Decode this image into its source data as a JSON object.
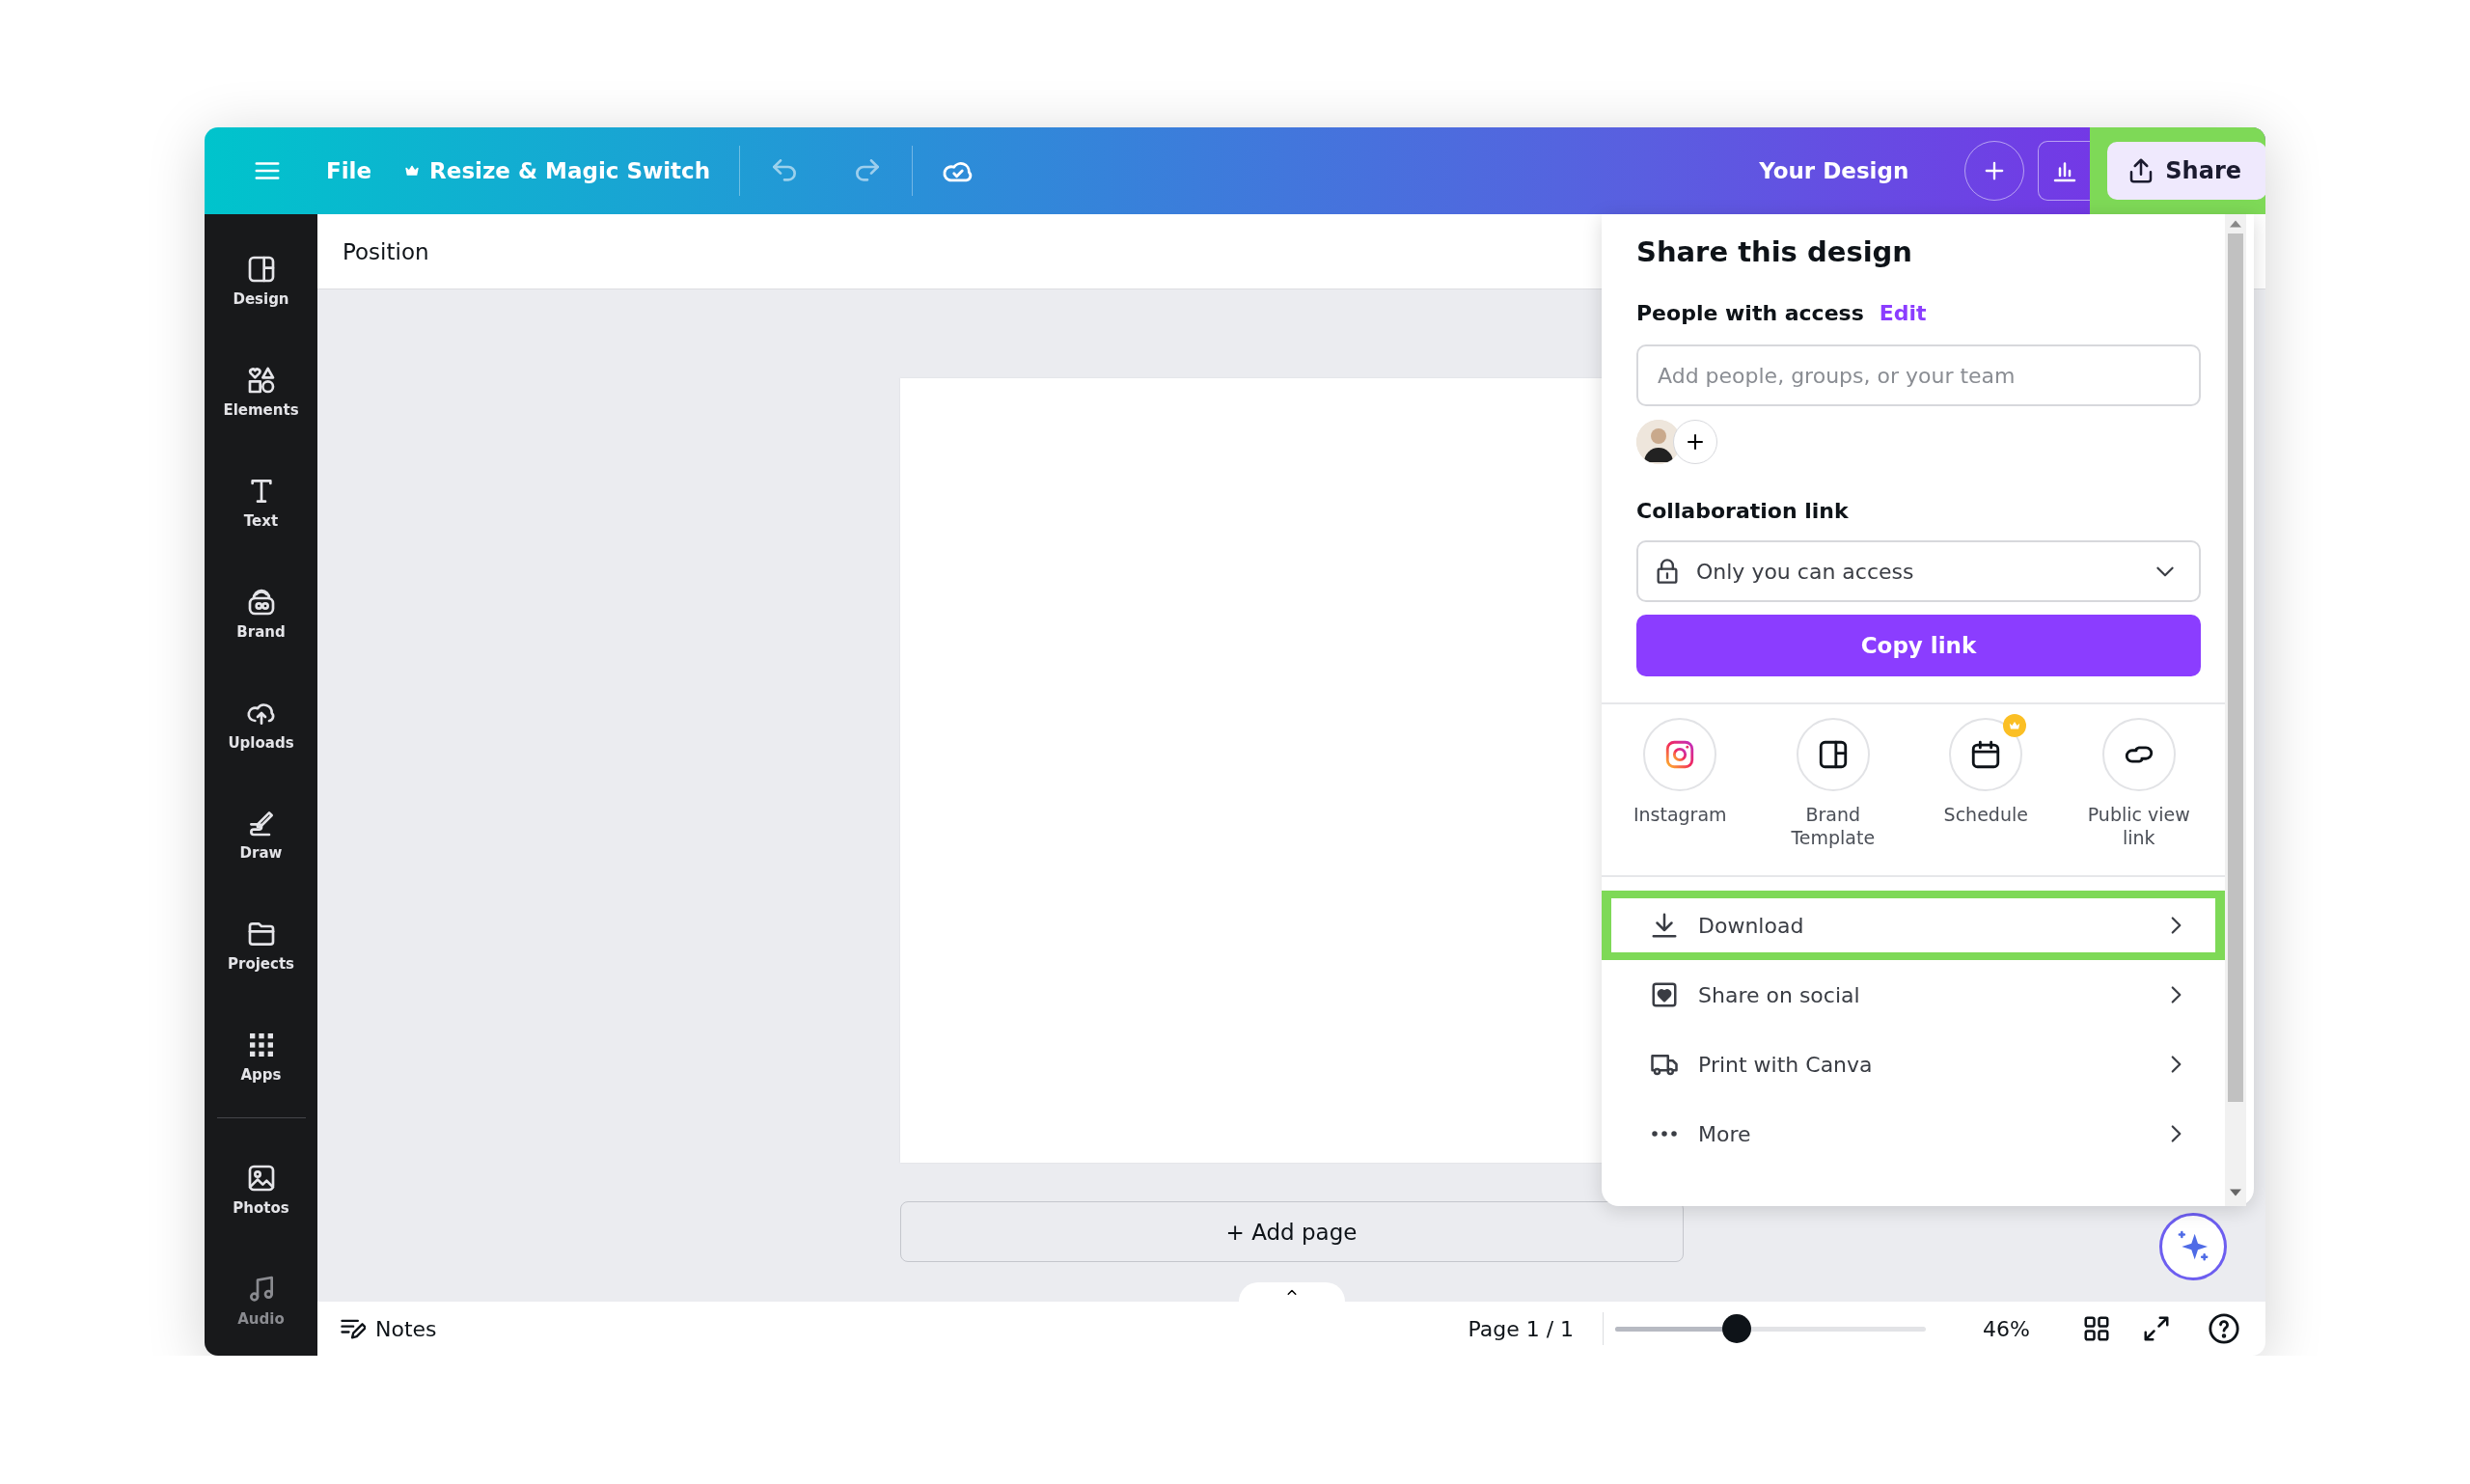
{
  "topbar": {
    "file_menu": "File",
    "resize_button": "Resize & Magic Switch",
    "design_title": "Your Design",
    "share_button": {
      "label": "Share",
      "highlighted": true
    }
  },
  "sidebar": {
    "items": [
      {
        "kind": "design",
        "label": "Design",
        "dimmed": false
      },
      {
        "kind": "elements",
        "label": "Elements",
        "dimmed": false
      },
      {
        "kind": "text",
        "label": "Text",
        "dimmed": false
      },
      {
        "kind": "brand",
        "label": "Brand",
        "dimmed": false
      },
      {
        "kind": "uploads",
        "label": "Uploads",
        "dimmed": false
      },
      {
        "kind": "draw",
        "label": "Draw",
        "dimmed": false
      },
      {
        "kind": "projects",
        "label": "Projects",
        "dimmed": false
      },
      {
        "kind": "apps",
        "label": "Apps",
        "dimmed": false
      },
      {
        "kind": "photos",
        "label": "Photos",
        "dimmed": false
      },
      {
        "kind": "audio",
        "label": "Audio",
        "dimmed": true
      }
    ]
  },
  "context_bar": {
    "label": "Position"
  },
  "canvas": {
    "add_page_button": "+ Add page"
  },
  "share_panel": {
    "title": "Share this design",
    "people_label": "People with access",
    "edit_link": "Edit",
    "people_field": {
      "placeholder": "Add people, groups, or your team"
    },
    "collaboration_label": "Collaboration link",
    "access_dropdown": "Only you can access",
    "copy_button": "Copy link",
    "targets": [
      {
        "kind": "instagram",
        "label": "Instagram",
        "premium": false
      },
      {
        "kind": "template",
        "label": "Brand Template",
        "premium": false
      },
      {
        "kind": "schedule",
        "label": "Schedule",
        "premium": true
      },
      {
        "kind": "link",
        "label": "Public view link",
        "premium": false
      }
    ],
    "menu": [
      {
        "kind": "download",
        "label": "Download",
        "highlighted": true
      },
      {
        "kind": "social",
        "label": "Share on social",
        "highlighted": false
      },
      {
        "kind": "print",
        "label": "Print with Canva",
        "highlighted": false
      },
      {
        "kind": "more",
        "label": "More",
        "highlighted": false
      }
    ]
  },
  "bottom_bar": {
    "notes": "Notes",
    "page_indicator": "Page 1 / 1",
    "zoom": {
      "level": 0.39
    },
    "zoom_reading": "46%"
  }
}
